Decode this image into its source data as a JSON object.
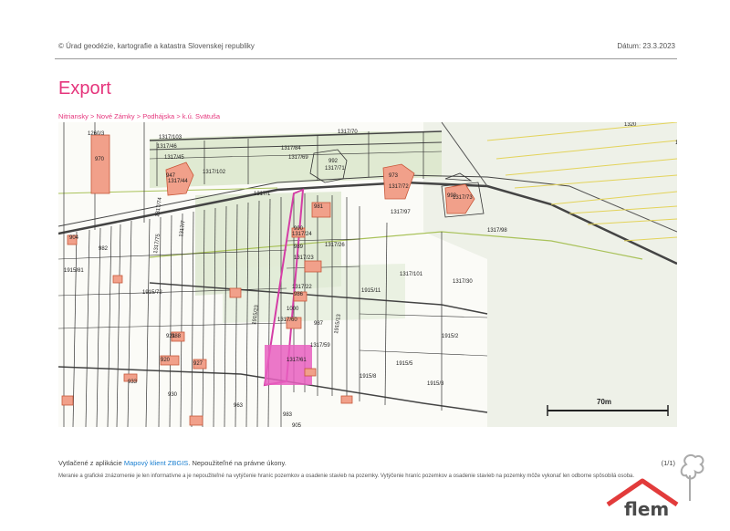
{
  "header": {
    "copyright": "© Úrad geodézie, kartografie a katastra Slovenskej republiky",
    "date_label": "Dátum: 23.3.2023"
  },
  "page": {
    "title": "Export"
  },
  "breadcrumb": [
    "Nitriansky",
    "Nové Zámky",
    "Podhájska",
    "k.ú. Svätuša"
  ],
  "breadcrumb_separator": ">",
  "map": {
    "scale_label": "70m",
    "parcel_labels": [
      "1317/103",
      "1317/46",
      "1317/45",
      "1317/44",
      "1317/102",
      "1317/84",
      "1317/69",
      "1317/70",
      "1317/71",
      "1317/72",
      "1317/73",
      "1317/97",
      "1317/98",
      "1317/1",
      "1317/24",
      "1317/26",
      "1317/23",
      "1317/22",
      "1317/101",
      "1317/30",
      "1317/60",
      "1317/61",
      "1317/59",
      "1317/74",
      "1317/7",
      "1317/75",
      "1915/81",
      "1915/72",
      "1915/11",
      "1915/2",
      "1915/5",
      "1915/8",
      "1915/3",
      "1915/23",
      "1915/13",
      "1260/3",
      "1320",
      "1356"
    ],
    "building_numbers": [
      "970",
      "992",
      "973",
      "993",
      "981",
      "947",
      "990",
      "989",
      "987",
      "986",
      "982",
      "988",
      "921",
      "920",
      "927",
      "1000",
      "930",
      "933",
      "963",
      "983",
      "905",
      "904"
    ]
  },
  "footer": {
    "printed_prefix": "Vytlačené z aplikácie ",
    "app_link": "Mapový klient ZBGIS",
    "printed_suffix": ". Nepoužiteľné na právne úkony.",
    "page_counter": "(1/1)",
    "disclaimer": "Meranie a grafické znázornenie je len informatívne a je nepoužiteľné na vytýčenie hraníc pozemkov a osadenie stavieb na pozemky. Vytýčenie hraníc pozemkov a osadenie stavieb na pozemky môže vykonať len odborne spôsobilá osoba."
  },
  "logo": {
    "text": "flem"
  },
  "colors": {
    "accent": "#e5357c",
    "link": "#1a7fd0",
    "building": "#f1a08a",
    "highlight_parcel": "#e85fc0",
    "green_area": "#d9e6c8"
  }
}
